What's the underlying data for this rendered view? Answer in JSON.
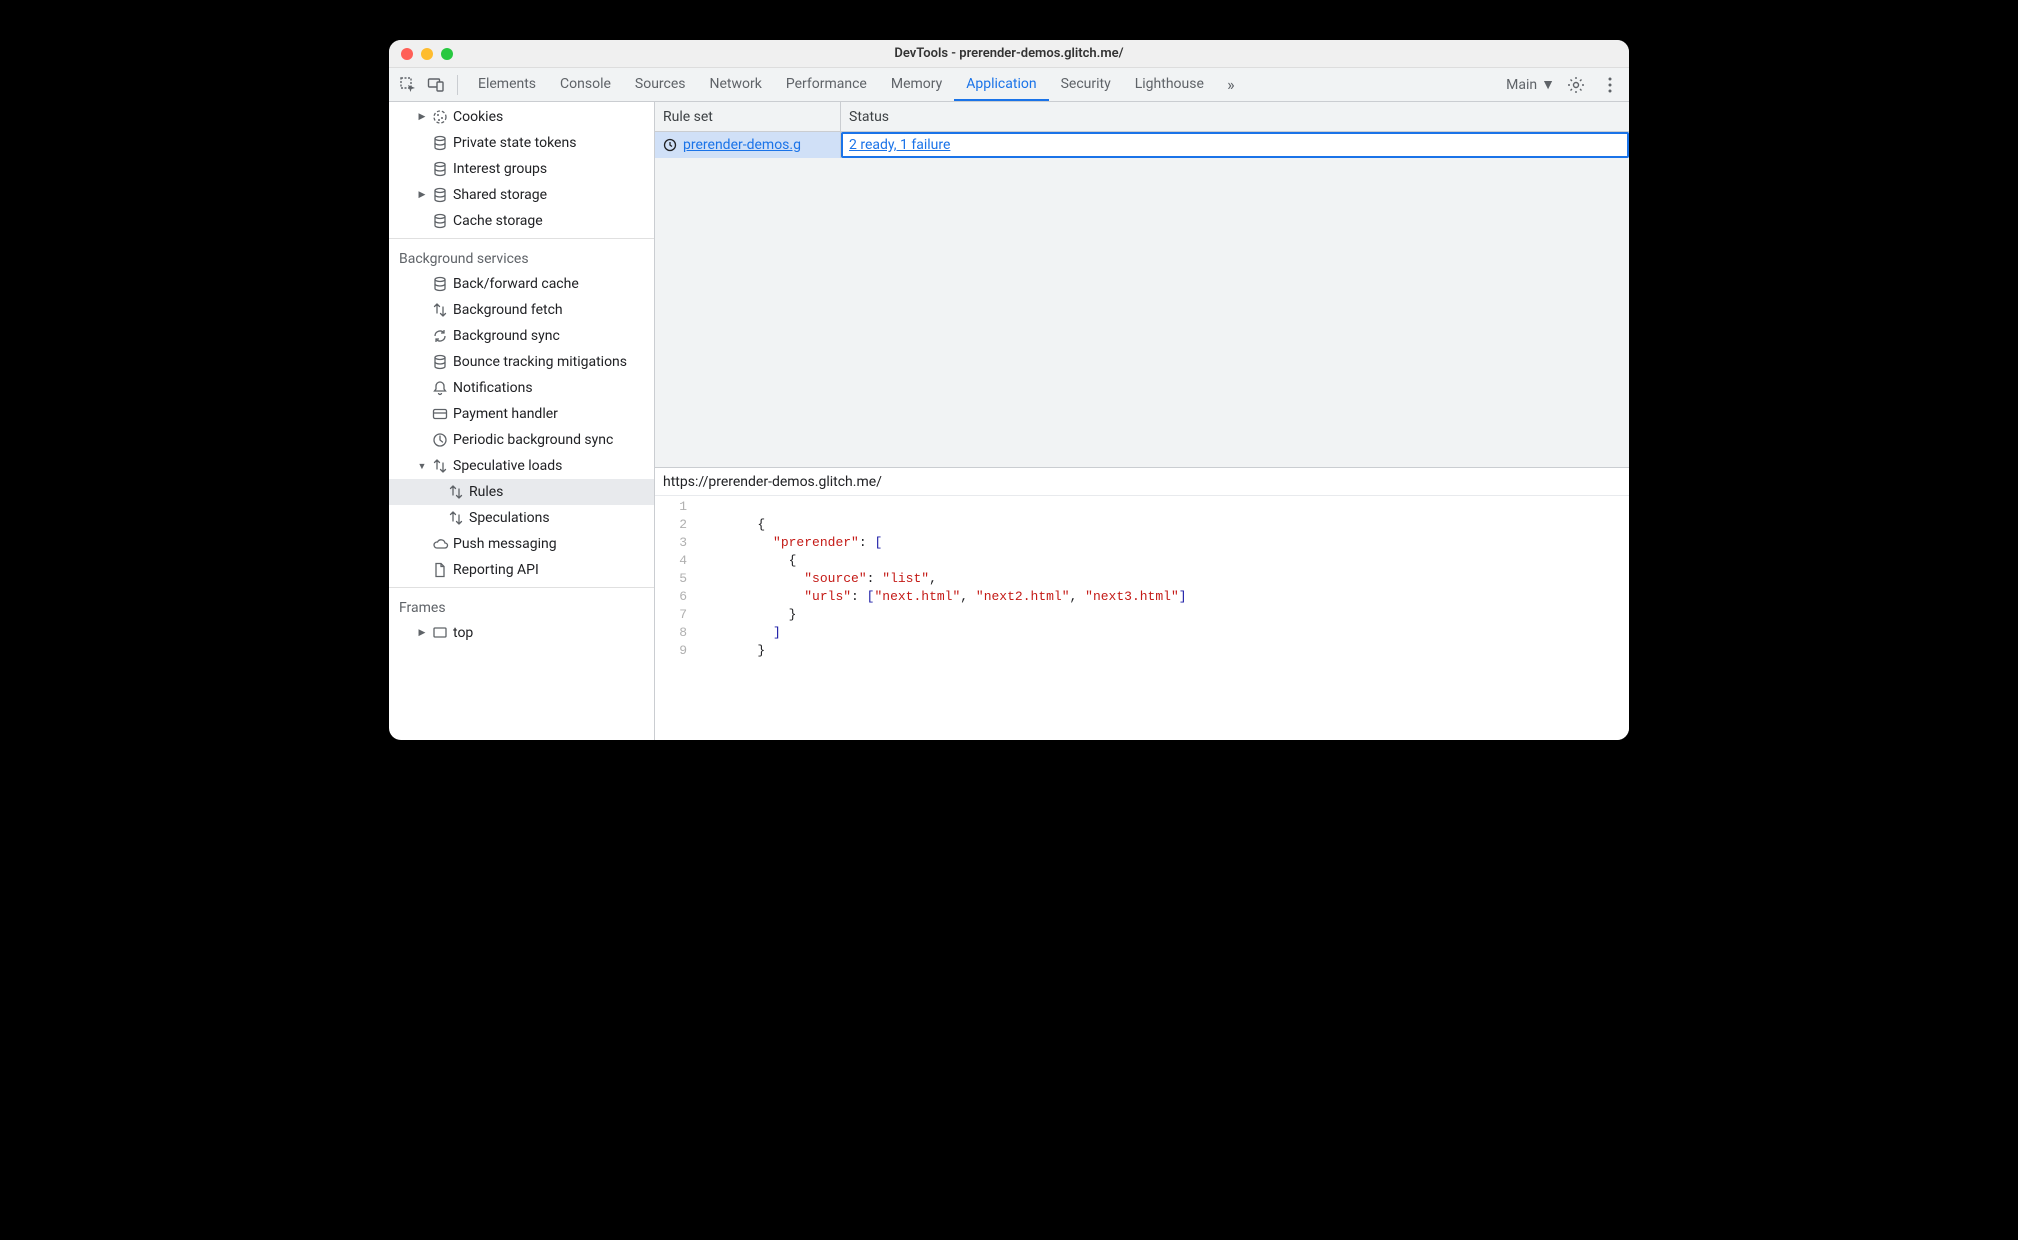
{
  "window": {
    "title": "DevTools - prerender-demos.glitch.me/"
  },
  "toolbar": {
    "tabs": [
      "Elements",
      "Console",
      "Sources",
      "Network",
      "Performance",
      "Memory",
      "Application",
      "Security",
      "Lighthouse"
    ],
    "active": "Application",
    "target_label": "Main"
  },
  "sidebar": {
    "storage": [
      {
        "label": "Cookies",
        "icon": "cookie",
        "arrow": true
      },
      {
        "label": "Private state tokens",
        "icon": "db"
      },
      {
        "label": "Interest groups",
        "icon": "db"
      },
      {
        "label": "Shared storage",
        "icon": "db",
        "arrow": true
      },
      {
        "label": "Cache storage",
        "icon": "db"
      }
    ],
    "bg_header": "Background services",
    "bg": [
      {
        "label": "Back/forward cache",
        "icon": "db"
      },
      {
        "label": "Background fetch",
        "icon": "updown"
      },
      {
        "label": "Background sync",
        "icon": "sync"
      },
      {
        "label": "Bounce tracking mitigations",
        "icon": "db"
      },
      {
        "label": "Notifications",
        "icon": "bell"
      },
      {
        "label": "Payment handler",
        "icon": "card"
      },
      {
        "label": "Periodic background sync",
        "icon": "clock"
      },
      {
        "label": "Speculative loads",
        "icon": "updown",
        "arrow": true,
        "open": true,
        "children": [
          {
            "label": "Rules",
            "icon": "updown",
            "selected": true
          },
          {
            "label": "Speculations",
            "icon": "updown"
          }
        ]
      },
      {
        "label": "Push messaging",
        "icon": "cloud"
      },
      {
        "label": "Reporting API",
        "icon": "doc"
      }
    ],
    "frames_header": "Frames",
    "frames": [
      {
        "label": "top",
        "icon": "frame",
        "arrow": true
      }
    ]
  },
  "grid": {
    "columns": {
      "ruleset": "Rule set",
      "status": "Status"
    },
    "rows": [
      {
        "ruleset": "prerender-demos.g",
        "status": "2 ready, 1 failure",
        "selected": true
      }
    ]
  },
  "details": {
    "url": "https://prerender-demos.glitch.me/",
    "code": {
      "lines": [
        1,
        2,
        3,
        4,
        5,
        6,
        7,
        8,
        9
      ],
      "tokens": [
        [],
        [
          {
            "t": "{",
            "c": "pun"
          }
        ],
        [
          {
            "t": "  ",
            "c": "pun"
          },
          {
            "t": "\"prerender\"",
            "c": "key"
          },
          {
            "t": ": ",
            "c": "colon"
          },
          {
            "t": "[",
            "c": "bracket"
          }
        ],
        [
          {
            "t": "    ",
            "c": "pun"
          },
          {
            "t": "{",
            "c": "pun"
          }
        ],
        [
          {
            "t": "      ",
            "c": "pun"
          },
          {
            "t": "\"source\"",
            "c": "key"
          },
          {
            "t": ": ",
            "c": "colon"
          },
          {
            "t": "\"list\"",
            "c": "str"
          },
          {
            "t": ",",
            "c": "pun"
          }
        ],
        [
          {
            "t": "      ",
            "c": "pun"
          },
          {
            "t": "\"urls\"",
            "c": "key"
          },
          {
            "t": ": ",
            "c": "colon"
          },
          {
            "t": "[",
            "c": "bracket"
          },
          {
            "t": "\"next.html\"",
            "c": "str"
          },
          {
            "t": ", ",
            "c": "pun"
          },
          {
            "t": "\"next2.html\"",
            "c": "str"
          },
          {
            "t": ", ",
            "c": "pun"
          },
          {
            "t": "\"next3.html\"",
            "c": "str"
          },
          {
            "t": "]",
            "c": "bracket"
          }
        ],
        [
          {
            "t": "    ",
            "c": "pun"
          },
          {
            "t": "}",
            "c": "pun"
          }
        ],
        [
          {
            "t": "  ",
            "c": "pun"
          },
          {
            "t": "]",
            "c": "bracket"
          }
        ],
        [
          {
            "t": "}",
            "c": "pun"
          }
        ]
      ]
    }
  }
}
